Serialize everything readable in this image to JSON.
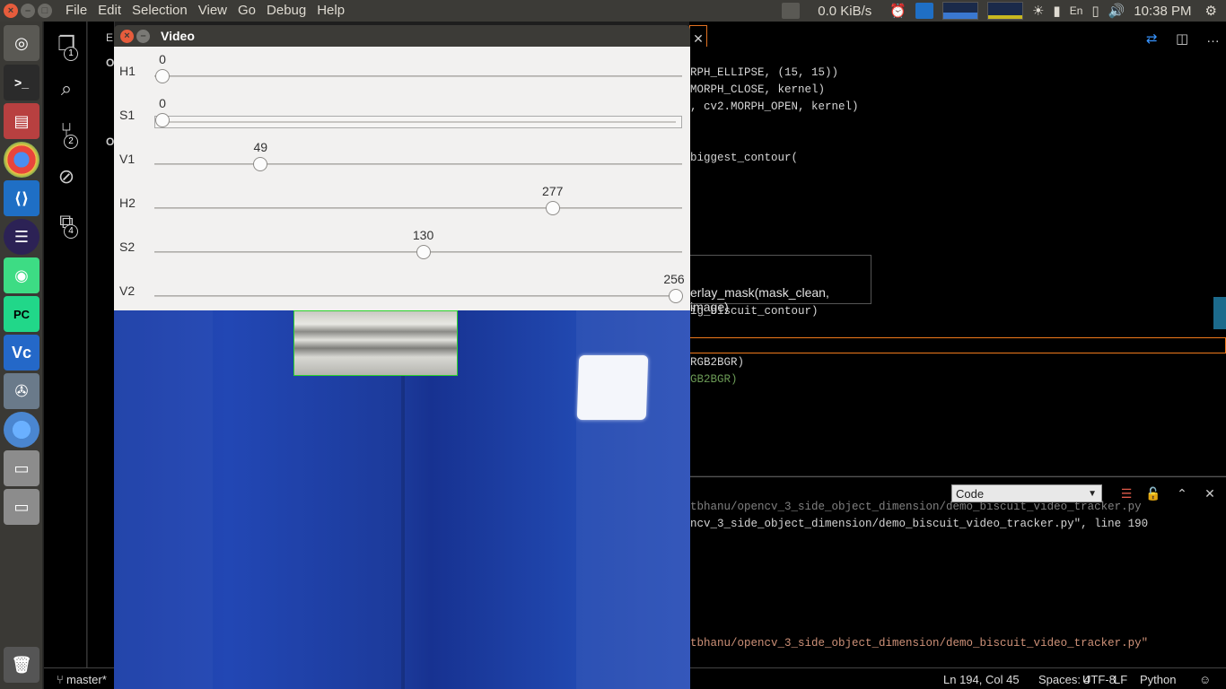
{
  "top_panel": {
    "menu": [
      "File",
      "Edit",
      "Selection",
      "View",
      "Go",
      "Debug",
      "Help"
    ],
    "net_speed": "0.0 KiB/s",
    "keyboard_layout": "En",
    "clock": "10:38 PM"
  },
  "launcher": {
    "items": [
      "ubuntu-dash",
      "terminal",
      "file-cabinet",
      "chrome",
      "vscode",
      "eclipse",
      "android-studio",
      "pycharm",
      "vscode-insiders",
      "film-reel",
      "chromium",
      "drive-1",
      "drive-2",
      "trash"
    ]
  },
  "activitybar": {
    "badges": [
      "1",
      "2",
      "4"
    ]
  },
  "sidebar": {
    "tab_stub": "E",
    "section_stub_1": "O",
    "section_stub_2": "O"
  },
  "editor": {
    "lines": [
      {
        "text": "RPH_ELLIPSE, (15, 15))"
      },
      {
        "text": "MORPH_CLOSE, kernel)"
      },
      {
        "text": ", cv2.MORPH_OPEN, kernel)"
      },
      {
        "text": "biggest_contour("
      },
      {
        "text": "ig_biscuit_contour)"
      },
      {
        "text": "RGB2BGR)"
      },
      {
        "text": "GB2BGR)"
      }
    ],
    "hover_text": "erlay_mask(mask_clean, image)"
  },
  "panel": {
    "select_value": "Code",
    "lines": [
      "tbhanu/opencv_3_side_object_dimension/demo_biscuit_video_tracker.py",
      "ncv_3_side_object_dimension/demo_biscuit_video_tracker.py\", line 190",
      "tbhanu/opencv_3_side_object_dimension/demo_biscuit_video_tracker.py\""
    ]
  },
  "statusbar": {
    "branch": "master*",
    "position": "Ln 194, Col 45",
    "spaces": "Spaces: 4",
    "encoding": "UTF-8",
    "eol": "LF",
    "language": "Python"
  },
  "video_window": {
    "title": "Video",
    "trackbars": [
      {
        "label": "H1",
        "value": "0",
        "fraction": 0.0
      },
      {
        "label": "S1",
        "value": "0",
        "fraction": 0.0
      },
      {
        "label": "V1",
        "value": "49",
        "fraction": 0.191
      },
      {
        "label": "H2",
        "value": "277",
        "fraction": 0.76
      },
      {
        "label": "S2",
        "value": "130",
        "fraction": 0.508
      },
      {
        "label": "V2",
        "value": "256",
        "fraction": 1.0
      }
    ]
  }
}
